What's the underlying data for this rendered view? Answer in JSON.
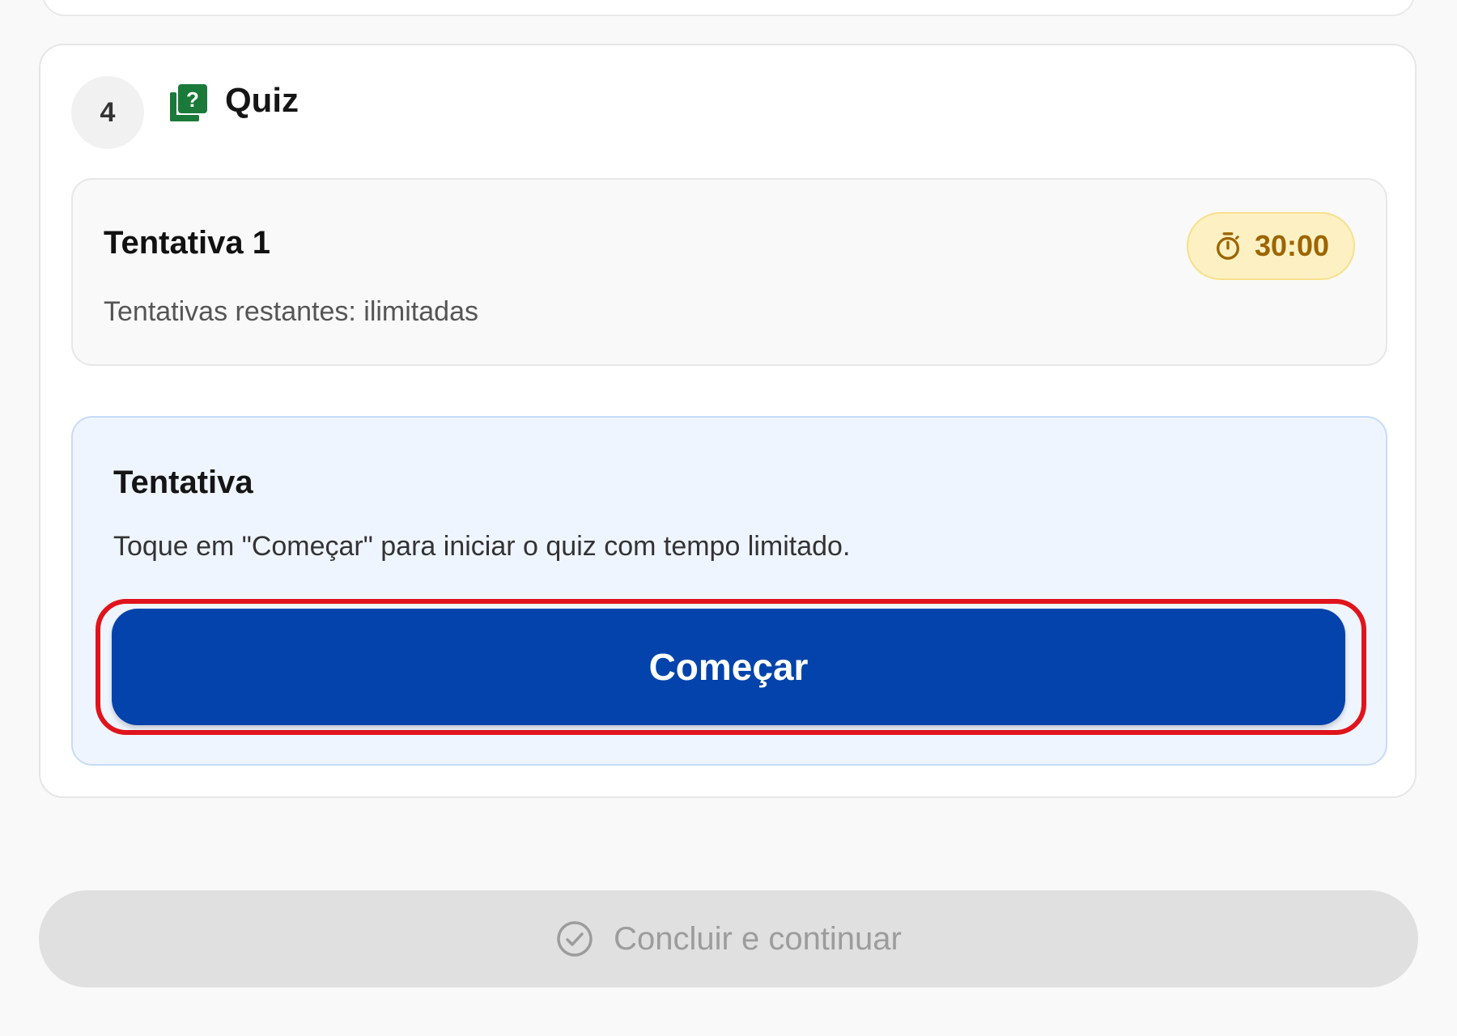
{
  "step": {
    "number": "4",
    "title": "Quiz",
    "icon": "quiz-book-icon"
  },
  "attempt_card": {
    "title": "Tentativa 1",
    "remaining": "Tentativas restantes: ilimitadas",
    "timer": "30:00",
    "timer_icon": "stopwatch-icon"
  },
  "attempt_panel": {
    "title": "Tentativa",
    "instruction": "Toque em \"Começar\" para iniciar o quiz com tempo limitado.",
    "start_label": "Começar"
  },
  "footer": {
    "finish_label": "Concluir e continuar",
    "finish_icon": "check-circle-icon",
    "finish_disabled": true
  },
  "colors": {
    "primary": "#0443ab",
    "timer_badge_bg": "#fdf1c4",
    "timer_text": "#9c6500",
    "panel_bg": "#eff5ff",
    "highlight": "#e0141c",
    "icon_green": "#1b7a3a",
    "disabled_bg": "#e0e0e0"
  }
}
